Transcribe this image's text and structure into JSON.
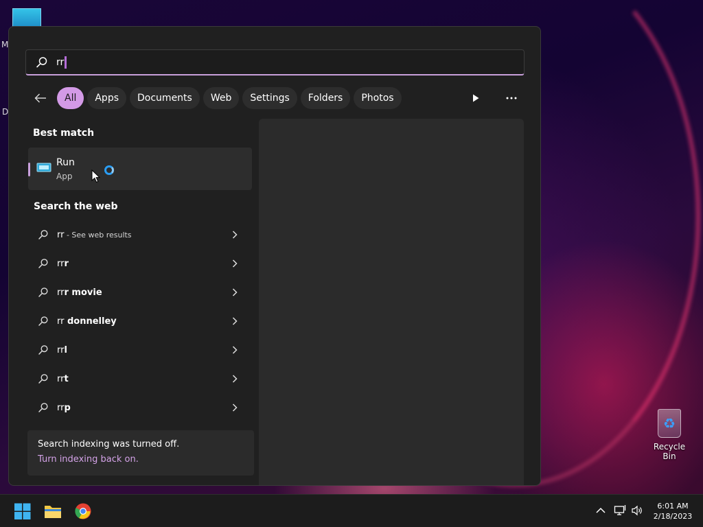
{
  "desktop": {
    "left_letters": [
      "M",
      "D"
    ],
    "recycle_bin_label": "Recycle Bin"
  },
  "search": {
    "query": "rr"
  },
  "filters": {
    "items": [
      "All",
      "Apps",
      "Documents",
      "Web",
      "Settings",
      "Folders",
      "Photos"
    ],
    "active": "All"
  },
  "best_match": {
    "title": "Best match",
    "name": "Run",
    "kind": "App"
  },
  "web": {
    "title": "Search the web",
    "first_suffix": " - See web results",
    "results": [
      {
        "base": "rr",
        "bold": ""
      },
      {
        "base": "rr",
        "bold": "r"
      },
      {
        "base": "rr",
        "bold": "r movie"
      },
      {
        "base": "rr",
        "bold": " donnelley"
      },
      {
        "base": "rr",
        "bold": "l"
      },
      {
        "base": "rr",
        "bold": "t"
      },
      {
        "base": "rr",
        "bold": "p"
      }
    ]
  },
  "notice": {
    "line1": "Search indexing was turned off.",
    "line2": "Turn indexing back on."
  },
  "taskbar": {
    "time": "6:01 AM",
    "date": "2/18/2023"
  },
  "colors": {
    "accent": "#d39ae6",
    "accent_text": "#d4a3e8",
    "panel_bg": "#202020",
    "taskbar_bg": "#1c1c1c"
  }
}
